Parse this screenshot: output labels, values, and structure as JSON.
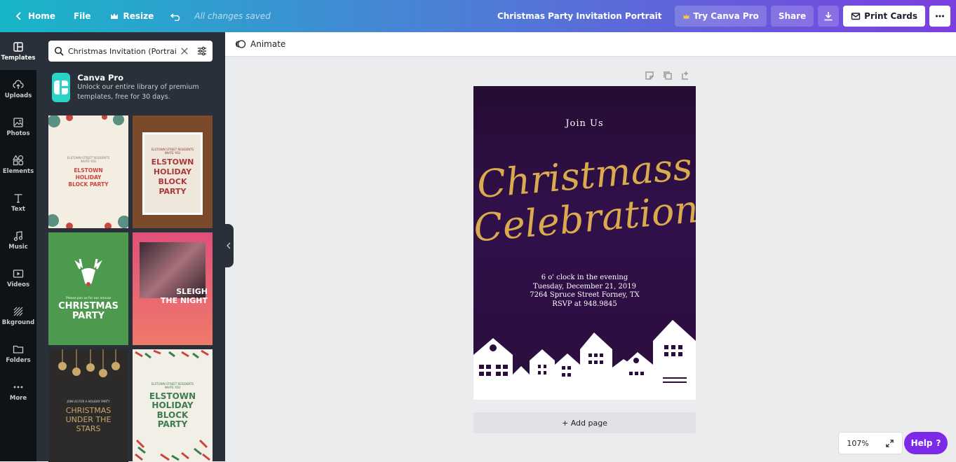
{
  "topbar": {
    "home": "Home",
    "file": "File",
    "resize": "Resize",
    "saved_status": "All changes saved",
    "doc_title": "Christmas Party Invitation Portrait",
    "try_pro": "Try Canva Pro",
    "share": "Share",
    "print": "Print Cards"
  },
  "sidebar": {
    "items": [
      {
        "label": "Templates",
        "icon": "templates-icon"
      },
      {
        "label": "Uploads",
        "icon": "upload-cloud-icon"
      },
      {
        "label": "Photos",
        "icon": "image-icon"
      },
      {
        "label": "Elements",
        "icon": "shapes-icon"
      },
      {
        "label": "Text",
        "icon": "text-icon"
      },
      {
        "label": "Music",
        "icon": "music-note-icon"
      },
      {
        "label": "Videos",
        "icon": "video-play-icon"
      },
      {
        "label": "Bkground",
        "icon": "background-hatch-icon"
      },
      {
        "label": "Folders",
        "icon": "folder-icon"
      },
      {
        "label": "More",
        "icon": "dots-icon"
      }
    ]
  },
  "panel": {
    "search_value": "Christmas Invitation (Portrait)",
    "promo_title": "Canva Pro",
    "promo_text": "Unlock our entire library of premium templates, free for 30 days.",
    "templates": [
      {
        "small": "ELSTOWN STREET RESIDENTS INVITE YOU",
        "title": "ELSTOWN HOLIDAY BLOCK PARTY"
      },
      {
        "small": "ELSTOWN STREET RESIDENTS INVITE YOU",
        "title": "ELSTOWN HOLIDAY BLOCK PARTY"
      },
      {
        "small": "Please join us for our annual",
        "title": "CHRISTMAS PARTY"
      },
      {
        "small": "",
        "title": "SLEIGH THE NIGHT"
      },
      {
        "small": "JOIN US FOR A HOLIDAY PARTY",
        "title": "CHRISTMAS UNDER THE STARS"
      },
      {
        "small": "ELSTOWN STREET RESIDENTS INVITE YOU",
        "title": "ELSTOWN HOLIDAY BLOCK PARTY"
      }
    ]
  },
  "editor": {
    "animate": "Animate",
    "add_page": "+ Add page",
    "zoom": "107%",
    "help": "Help"
  },
  "design": {
    "join_us": "Join Us",
    "line1": "Christmass",
    "line2": "Celebration",
    "details": [
      "6 o' clock in the evening",
      "Tuesday, December 21, 2019",
      "7264 Spruce Street Forney, TX",
      "RSVP at 948.9845"
    ]
  }
}
